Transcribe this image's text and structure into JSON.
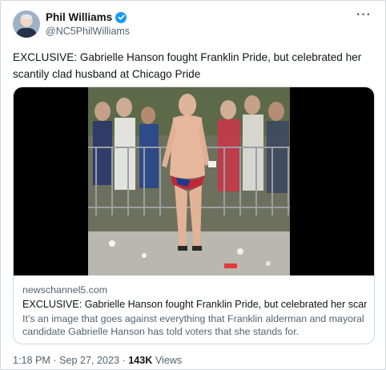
{
  "author": {
    "display_name": "Phil Williams",
    "handle": "@NC5PhilWilliams",
    "verified_icon": "verified-badge-icon",
    "avatar_icon": "profile-photo"
  },
  "menu": {
    "more_label": "···"
  },
  "tweet": {
    "text": "EXCLUSIVE: Gabrielle Hanson fought Franklin Pride, but celebrated her scantily clad husband at Chicago Pride"
  },
  "card": {
    "domain": "newschannel5.com",
    "title": "EXCLUSIVE: Gabrielle Hanson fought Franklin Pride, but celebrated her scant...",
    "description": "It’s an image that goes against everything that Franklin alderman and mayoral candidate Gabrielle Hanson has told voters that she stands for."
  },
  "meta": {
    "time": "1:18 PM",
    "separator": "·",
    "date": "Sep 27, 2023",
    "views_count": "143K",
    "views_label": "Views"
  },
  "colors": {
    "verified_blue": "#1d9bf0",
    "secondary_text": "#536471",
    "border": "#cfd9de"
  }
}
